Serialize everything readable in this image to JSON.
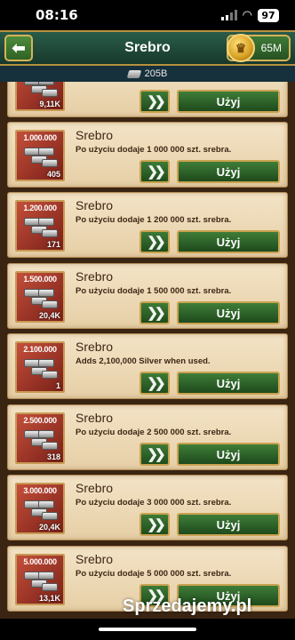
{
  "status_bar": {
    "time": "08:16",
    "battery": "97"
  },
  "header": {
    "title": "Srebro",
    "gold_amount": "65M"
  },
  "subbar": {
    "silver_amount": "205B"
  },
  "items": [
    {
      "name": "",
      "thumb_label": "",
      "count": "9,11K",
      "desc": ""
    },
    {
      "name": "Srebro",
      "thumb_label": "1.000.000",
      "count": "405",
      "desc": "Po użyciu dodaje 1 000 000 szt. srebra."
    },
    {
      "name": "Srebro",
      "thumb_label": "1.200.000",
      "count": "171",
      "desc": "Po użyciu dodaje 1 200 000 szt. srebra."
    },
    {
      "name": "Srebro",
      "thumb_label": "1.500.000",
      "count": "20,4K",
      "desc": "Po użyciu dodaje 1 500 000 szt. srebra."
    },
    {
      "name": "Srebro",
      "thumb_label": "2.100.000",
      "count": "1",
      "desc": "Adds 2,100,000 Silver when used."
    },
    {
      "name": "Srebro",
      "thumb_label": "2.500.000",
      "count": "318",
      "desc": "Po użyciu dodaje 2 500 000 szt. srebra."
    },
    {
      "name": "Srebro",
      "thumb_label": "3.000.000",
      "count": "20,4K",
      "desc": "Po użyciu dodaje 3 000 000 szt. srebra."
    },
    {
      "name": "Srebro",
      "thumb_label": "5.000.000",
      "count": "13,1K",
      "desc": "Po użyciu dodaje 5 000 000 szt. srebra."
    }
  ],
  "buttons": {
    "use_label": "Użyj",
    "fast_forward_glyph": "❯❯"
  },
  "watermark": "Sprzedajemy.pl",
  "colors": {
    "header_green": "#2a5c49",
    "button_green": "#3f7d38",
    "gold_border": "#c9a24f",
    "parchment": "#f3e3c6"
  }
}
